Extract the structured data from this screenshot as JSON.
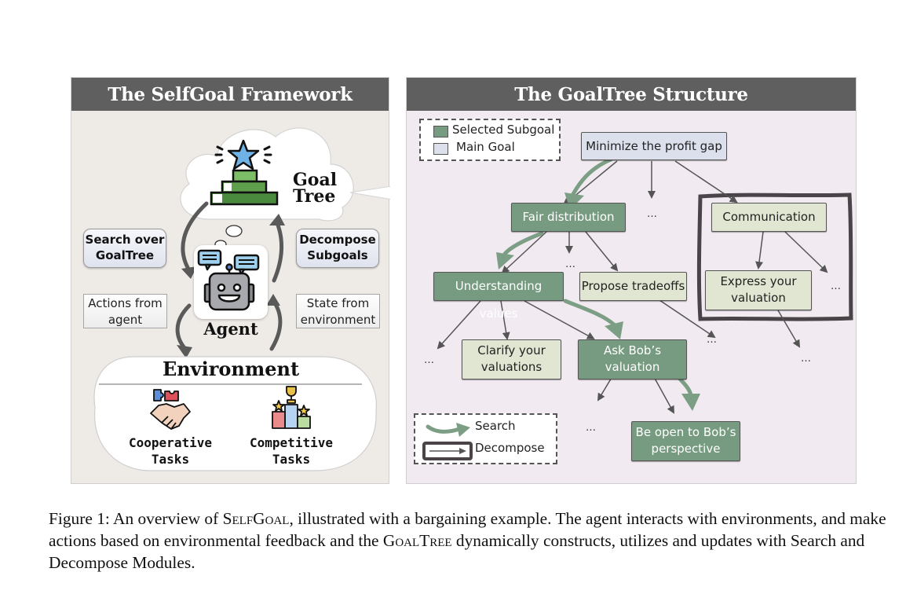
{
  "left_panel": {
    "title": "The SelfGoal Framework",
    "goal_tree_label_line1": "Goal",
    "goal_tree_label_line2": "Tree",
    "search_module": {
      "line1": "Search over",
      "line2": "GoalTree"
    },
    "decompose_module": {
      "line1": "Decompose",
      "line2": "Subgoals"
    },
    "actions_label": {
      "line1": "Actions from",
      "line2": "agent"
    },
    "state_label": {
      "line1": "State from",
      "line2": "environment"
    },
    "agent_label": "Agent",
    "environment_title": "Environment",
    "cooperative": {
      "line1": "Cooperative",
      "line2": "Tasks"
    },
    "competitive": {
      "line1": "Competitive",
      "line2": "Tasks"
    }
  },
  "right_panel": {
    "title": "The GoalTree Structure",
    "legend_top": {
      "selected": "Selected Subgoal",
      "main": "Main Goal"
    },
    "legend_bottom": {
      "search": "Search",
      "decompose": "Decompose"
    },
    "nodes": {
      "root": "Minimize the profit gap",
      "fair": "Fair distribution",
      "communication": "Communication",
      "understanding": "Understanding values",
      "propose": "Propose tradeoffs",
      "express_l1": "Express your",
      "express_l2": "valuation",
      "clarify_l1": "Clarify your",
      "clarify_l2": "valuations",
      "askbob_l1": "Ask Bob’s",
      "askbob_l2": "valuation",
      "open_l1": "Be open to Bob’s",
      "open_l2": "perspective"
    },
    "ellipsis": "…"
  },
  "colors": {
    "selected_subgoal": "#779b80",
    "main_goal": "#dbe0ec",
    "plain_subgoal": "#e1e6d2",
    "search_arrow": "#7c9e84",
    "header_bg": "#5f5f5f"
  },
  "caption": {
    "prefix": "Figure 1: An overview of ",
    "selfgoal": "SelfGoal",
    "mid": ", illustrated with a bargaining example. The agent interacts with environments, and make actions based on environmental feedback and the ",
    "goaltree": "GoalTree",
    "suffix": " dynamically constructs, utilizes and updates with Search and Decompose Modules."
  }
}
